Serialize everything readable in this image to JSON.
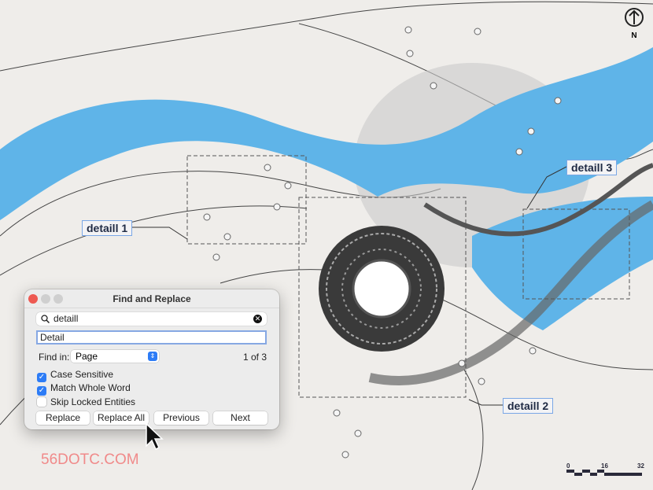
{
  "map": {
    "labels": [
      "detaill 1",
      "detaill 2",
      "detaill 3"
    ],
    "north": "N",
    "scale_ticks": [
      "0",
      "16",
      "32"
    ],
    "river_color": "#5fb4e8"
  },
  "watermark": "56DOTC.COM",
  "dialog": {
    "title": "Find and Replace",
    "search_value": "detaill",
    "replace_value": "Detail",
    "find_in_label": "Find in:",
    "find_in_value": "Page",
    "match_count": "1 of 3",
    "options": [
      {
        "label": "Case Sensitive",
        "checked": true
      },
      {
        "label": "Match Whole Word",
        "checked": true
      },
      {
        "label": "Skip Locked Entities",
        "checked": false
      }
    ],
    "buttons": [
      "Replace",
      "Replace All",
      "Previous",
      "Next"
    ],
    "accent": "#2d7cf6"
  }
}
